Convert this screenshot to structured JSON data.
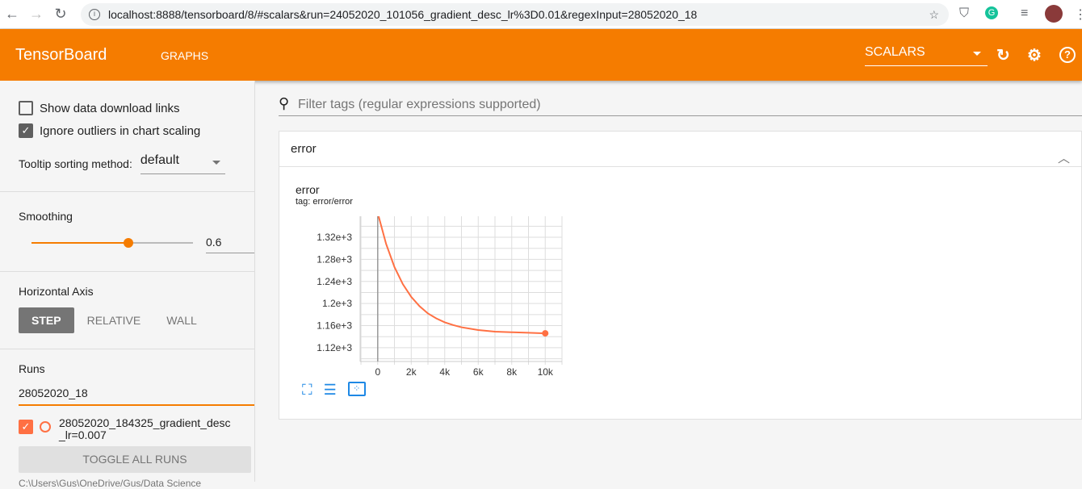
{
  "browser": {
    "url": "localhost:8888/tensorboard/8/#scalars&run=24052020_101056_gradient_desc_lr%3D0.01&regexInput=28052020_18"
  },
  "header": {
    "brand": "TensorBoard",
    "nav": "GRAPHS",
    "dashboard_select": "SCALARS",
    "accent": "#f57c00"
  },
  "sidebar": {
    "show_download": "Show data download links",
    "show_download_checked": false,
    "ignore_outliers": "Ignore outliers in chart scaling",
    "ignore_outliers_checked": true,
    "tooltip_label": "Tooltip sorting method:",
    "tooltip_value": "default",
    "smoothing_label": "Smoothing",
    "smoothing_value": "0.6",
    "haxis_label": "Horizontal Axis",
    "haxis_options": [
      "STEP",
      "RELATIVE",
      "WALL"
    ],
    "haxis_selected": "STEP",
    "runs_label": "Runs",
    "runs_filter": "28052020_18",
    "runs": [
      {
        "name": "28052020_184325_gradient_desc_lr=0.007",
        "checked": true,
        "color": "#ff7043"
      }
    ],
    "toggle_all": "TOGGLE ALL RUNS",
    "logdir": "C:\\Users\\Gus\\OneDrive/Gus/Data Science"
  },
  "main": {
    "filter_placeholder": "Filter tags (regular expressions supported)",
    "category": "error",
    "chart_title": "error",
    "chart_tag": "tag: error/error"
  },
  "chart_data": {
    "type": "line",
    "title": "error",
    "xlabel": "",
    "ylabel": "",
    "xlim": [
      -1050,
      11000
    ],
    "ylim": [
      1095,
      1358
    ],
    "xticks": [
      "0",
      "2k",
      "4k",
      "6k",
      "8k",
      "10k"
    ],
    "xtick_values": [
      0,
      2000,
      4000,
      6000,
      8000,
      10000
    ],
    "yticks": [
      "1.12e+3",
      "1.16e+3",
      "1.2e+3",
      "1.24e+3",
      "1.28e+3",
      "1.32e+3"
    ],
    "ytick_values": [
      1120,
      1160,
      1200,
      1240,
      1280,
      1320
    ],
    "grid": true,
    "series": [
      {
        "color": "#ff7043",
        "x": [
          0,
          500,
          1000,
          1500,
          2000,
          2500,
          3000,
          3500,
          4000,
          4500,
          5000,
          6000,
          7000,
          8000,
          9000,
          10000
        ],
        "y": [
          1364,
          1308,
          1266,
          1235,
          1212,
          1195,
          1182,
          1173,
          1166,
          1161,
          1157,
          1152,
          1149,
          1148,
          1147,
          1146
        ]
      }
    ]
  }
}
